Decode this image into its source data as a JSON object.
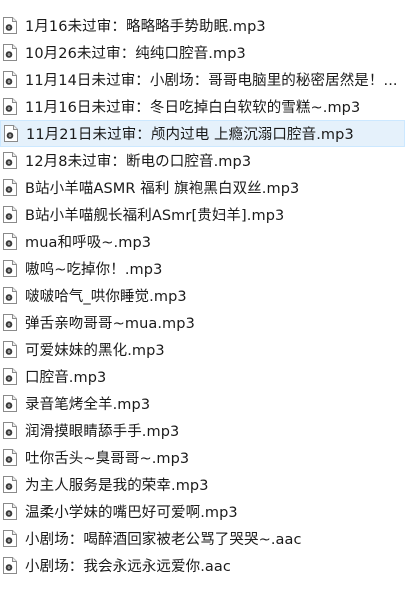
{
  "files": [
    {
      "name": "1月16未过审：略略略手势助眠.mp3",
      "icon": "audio-file-icon",
      "selected": false
    },
    {
      "name": "10月26未过审：纯纯口腔音.mp3",
      "icon": "audio-file-icon",
      "selected": false
    },
    {
      "name": "11月14日未过审：小剧场：哥哥电脑里的秘密居然是！...",
      "icon": "audio-file-icon",
      "selected": false
    },
    {
      "name": "11月16日未过审：冬日吃掉白白软软的雪糕~.mp3",
      "icon": "audio-file-icon",
      "selected": false
    },
    {
      "name": "11月21日未过审：颅内过电 上瘾沉溺口腔音.mp3",
      "icon": "audio-file-icon",
      "selected": true
    },
    {
      "name": "12月8未过审：断电の口腔音.mp3",
      "icon": "audio-file-icon",
      "selected": false
    },
    {
      "name": "B站小羊喵ASMR 福利 旗袍黑白双丝.mp3",
      "icon": "audio-file-icon",
      "selected": false
    },
    {
      "name": "B站小羊喵舰长福利ASmr[贵妇羊].mp3",
      "icon": "audio-file-icon",
      "selected": false
    },
    {
      "name": "mua和呼吸~.mp3",
      "icon": "audio-file-icon",
      "selected": false
    },
    {
      "name": "嗷呜~吃掉你！.mp3",
      "icon": "audio-file-icon",
      "selected": false
    },
    {
      "name": "啵啵哈气_哄你睡觉.mp3",
      "icon": "audio-file-icon",
      "selected": false
    },
    {
      "name": "弹舌亲吻哥哥~mua.mp3",
      "icon": "audio-file-icon",
      "selected": false
    },
    {
      "name": "可爱妹妹的黑化.mp3",
      "icon": "audio-file-icon",
      "selected": false
    },
    {
      "name": "口腔音.mp3",
      "icon": "audio-file-icon",
      "selected": false
    },
    {
      "name": "录音笔烤全羊.mp3",
      "icon": "audio-file-icon",
      "selected": false
    },
    {
      "name": "润滑摸眼睛舔手手.mp3",
      "icon": "audio-file-icon",
      "selected": false
    },
    {
      "name": "吐你舌头~臭哥哥~.mp3",
      "icon": "audio-file-icon",
      "selected": false
    },
    {
      "name": "为主人服务是我的荣幸.mp3",
      "icon": "audio-file-icon",
      "selected": false
    },
    {
      "name": "温柔小学妹的嘴巴好可爱啊.mp3",
      "icon": "audio-file-icon",
      "selected": false
    },
    {
      "name": "小剧场：喝醉酒回家被老公骂了哭哭~.aac",
      "icon": "audio-file-icon",
      "selected": false
    },
    {
      "name": "小剧场：我会永远永远爱你.aac",
      "icon": "audio-file-icon",
      "selected": false
    }
  ],
  "colors": {
    "selection_bg": "#e5f1fb",
    "selection_border": "#cce8ff",
    "text": "#1a1a1a"
  }
}
